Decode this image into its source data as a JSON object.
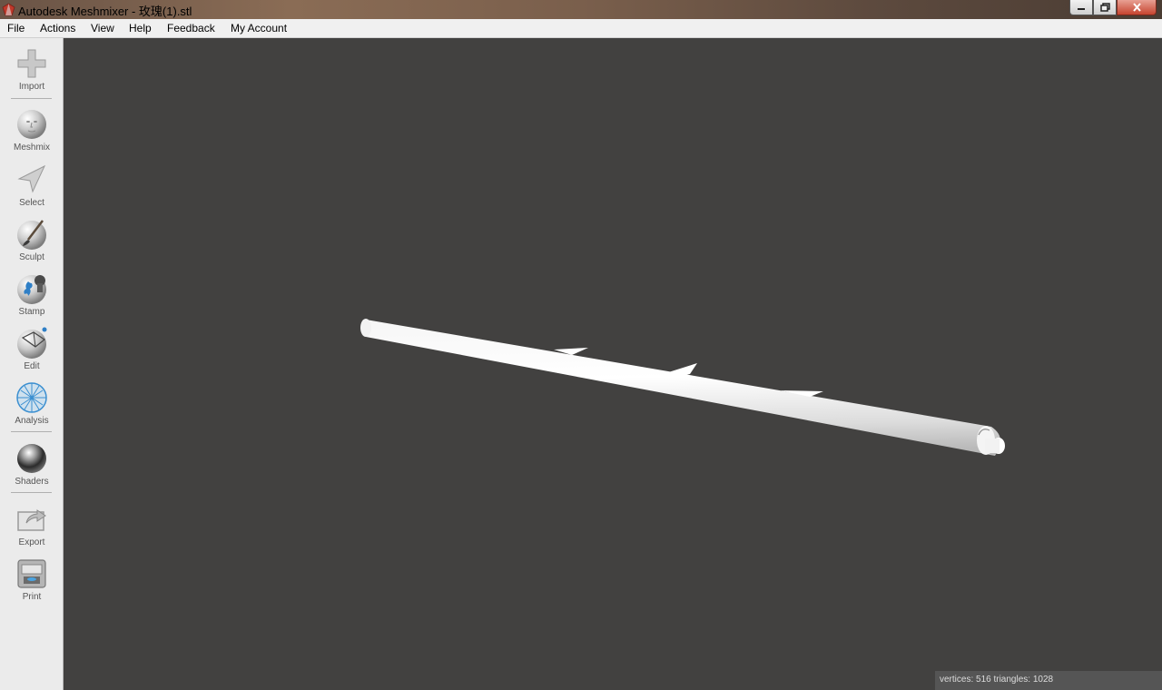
{
  "window": {
    "title": "Autodesk Meshmixer - 玫瑰(1).stl",
    "controls": [
      "minimize-icon",
      "restore-icon",
      "close-icon"
    ]
  },
  "menu": {
    "items": [
      "File",
      "Actions",
      "View",
      "Help",
      "Feedback",
      "My Account"
    ]
  },
  "toolbar": {
    "tools": [
      {
        "label": "Import",
        "icon": "plus-icon"
      },
      {
        "label": "Meshmix",
        "icon": "face-sphere-icon"
      },
      {
        "label": "Select",
        "icon": "arrow-pointer-icon"
      },
      {
        "label": "Sculpt",
        "icon": "brush-sphere-icon"
      },
      {
        "label": "Stamp",
        "icon": "stamp-sphere-icon"
      },
      {
        "label": "Edit",
        "icon": "edit-sphere-icon"
      },
      {
        "label": "Analysis",
        "icon": "analysis-sphere-icon"
      },
      {
        "label": "Shaders",
        "icon": "chrome-sphere-icon"
      },
      {
        "label": "Export",
        "icon": "export-icon"
      },
      {
        "label": "Print",
        "icon": "printer-icon"
      }
    ]
  },
  "viewport": {
    "background": "#424140",
    "model": "long thin rod with three small fins"
  },
  "status": {
    "text": "vertices: 516 triangles: 1028"
  }
}
